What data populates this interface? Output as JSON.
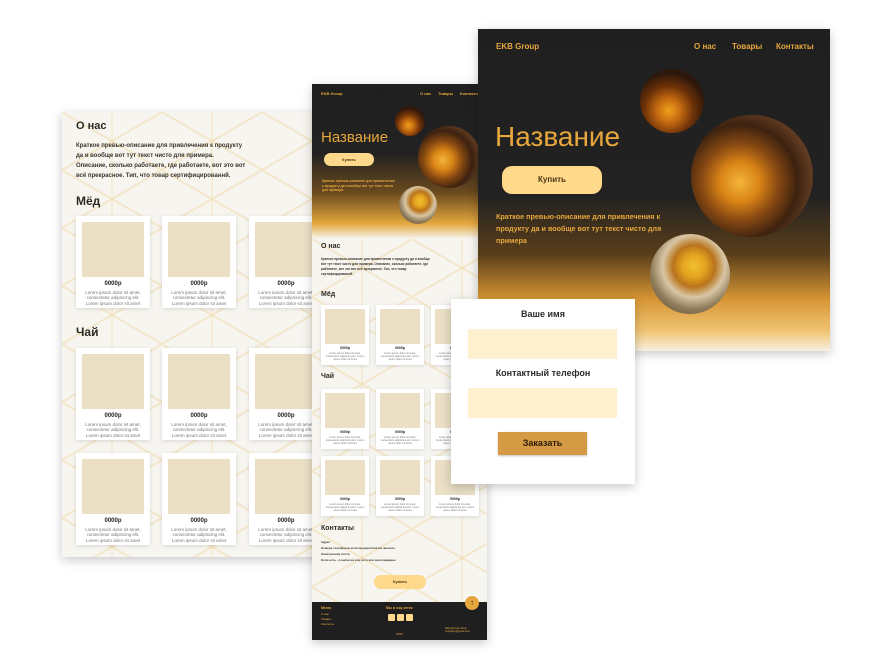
{
  "left": {
    "about_title": "О нас",
    "about_text": "Краткое превью-описание для  привлечения к продукту да и вообще вот тут текст чисто для примера. Описание, сколько работаете, где работаете, вот это вот всё прекрасное. Тип, что товар сертифицированнй.",
    "honey_title": "Мёд",
    "tea_title": "Чай",
    "price": "0000р",
    "desc": "Lorem ipsum dolor sit amet, consectetur adipiscing elit. Lorem ipsum dolor sit amet"
  },
  "mid": {
    "brand": "EKB Group",
    "nav": [
      "О нас",
      "Товары",
      "Контакты"
    ],
    "title": "Название",
    "buy": "Купить",
    "lead": "Краткое превью-описание для  привлечения к продукту да и вообще вот тут текст чисто для примера",
    "about_title": "О нас",
    "about_text": "Краткое превью-описание для  привлечения к продукту да и вообще вот тут текст чисто для примера. Описание, сколько работаете, где работаете, вот это вот всё прекрасное. Тип, что товар сертифицированнй.",
    "honey_title": "Мёд",
    "tea_title": "Чай",
    "price": "0000р",
    "desc": "Lorem ipsum dolor sit amet, consectetur adipiscing elit. Lorem ipsum dolor sit amet",
    "contacts_title": "Контакты",
    "contacts_lines": [
      "Адрес",
      "Номера телефонов если предполагается звонить",
      "Электронная почта",
      "Если есть - ссылки на соц сети или мессенджеры"
    ],
    "contacts_btn": "Купить",
    "footer_col1_title": "Меню",
    "footer_col1": [
      "О нас",
      "Товары",
      "Контакты"
    ],
    "footer_social": "Мы в соц сетях",
    "footer_year": "2022",
    "footer_right": "Разработка сайта: company@gmail.com"
  },
  "right": {
    "brand": "EKB Group",
    "nav": [
      "О нас",
      "Товары",
      "Контакты"
    ],
    "title": "Название",
    "buy": "Купить",
    "lead": "Краткое превью-описание для  привлечения к продукту да и вообще вот тут текст чисто для примера"
  },
  "form": {
    "name_label": "Ваше имя",
    "name_value": "",
    "phone_label": "Контактный телефон",
    "phone_value": "",
    "submit": "Заказать"
  },
  "colors": {
    "accent": "#ffd98b",
    "dark": "#1f1f1f",
    "gold_text": "#e7a73d",
    "submit": "#d49a44",
    "field": "#fff1cf"
  }
}
